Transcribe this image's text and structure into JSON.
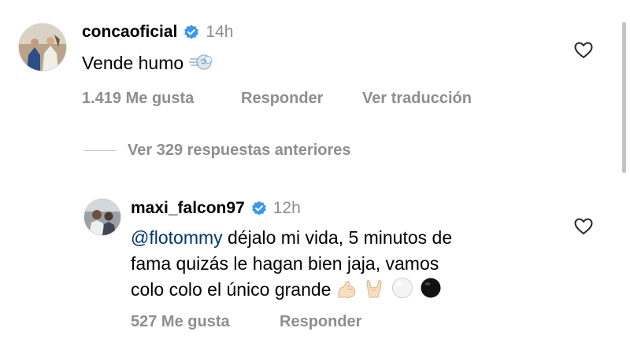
{
  "main_comment": {
    "username": "concaoficial",
    "time": "14h",
    "text": "Vende humo",
    "text_emoji": "dash-icon",
    "likes": "1.419 Me gusta",
    "reply_label": "Responder",
    "translate_label": "Ver traducción"
  },
  "view_replies": {
    "label": "Ver 329 respuestas anteriores"
  },
  "reply": {
    "username": "maxi_falcon97",
    "time": "12h",
    "mention": "@flotommy",
    "line1_rest": " déjalo mi vida, 5 minutos de",
    "line2": "fama quizás le hagan bien jaja, vamos",
    "line3": "colo colo el único grande",
    "emojis": [
      "flexed-biceps-icon",
      "sign-of-horns-icon",
      "white-circle-icon",
      "black-circle-icon"
    ],
    "likes": "527 Me gusta",
    "reply_label": "Responder"
  },
  "colors": {
    "verified": "#3897f0",
    "secondary_text": "#8e8e8e",
    "mention": "#00376b"
  }
}
